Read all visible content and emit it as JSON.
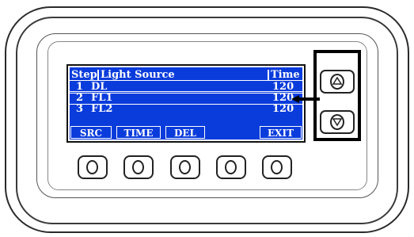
{
  "screen": {
    "header": {
      "step": "Step",
      "source": "Light Source",
      "time": "Time"
    },
    "rows": [
      {
        "step": "1",
        "source": "DL",
        "time": "120"
      },
      {
        "step": "2",
        "source": "FL1",
        "time": "120"
      },
      {
        "step": "3",
        "source": "FL2",
        "time": "120"
      }
    ],
    "softkeys": [
      "SRC",
      "TIME",
      "DEL",
      "EXIT"
    ]
  },
  "colors": {
    "lcd": "#0a3cdc",
    "highlight": "#000000"
  },
  "icons": {
    "up": "triangle-up-icon",
    "down": "triangle-down-icon"
  }
}
